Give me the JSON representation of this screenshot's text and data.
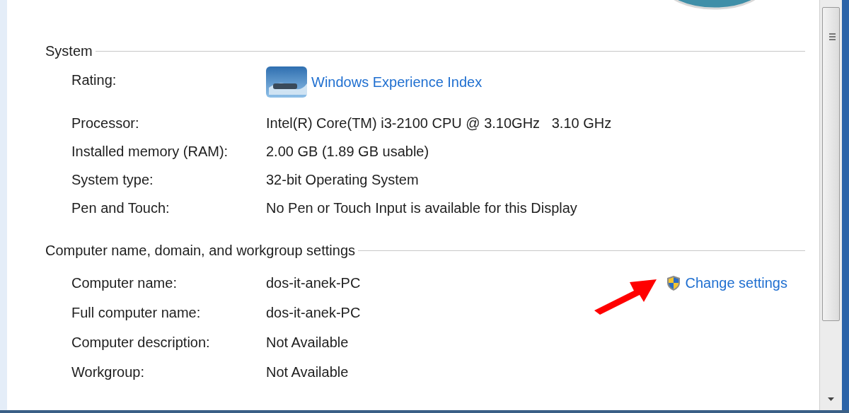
{
  "sections": [
    {
      "heading": "System",
      "rows": [
        {
          "label": "Rating:",
          "value": "Windows Experience Index",
          "kind": "link"
        },
        {
          "label": "Processor:",
          "value": "Intel(R) Core(TM) i3-2100 CPU @ 3.10GHz   3.10 GHz",
          "kind": "text"
        },
        {
          "label": "Installed memory (RAM):",
          "value": "2.00 GB (1.89 GB usable)",
          "kind": "text"
        },
        {
          "label": "System type:",
          "value": "32-bit Operating System",
          "kind": "text"
        },
        {
          "label": "Pen and Touch:",
          "value": "No Pen or Touch Input is available for this Display",
          "kind": "text"
        }
      ]
    },
    {
      "heading": "Computer name, domain, and workgroup settings",
      "action": {
        "label": "Change settings",
        "arrow": true
      },
      "rows": [
        {
          "label": "Computer name:",
          "value": "dos-it-anek-PC",
          "kind": "text"
        },
        {
          "label": "Full computer name:",
          "value": "dos-it-anek-PC",
          "kind": "text"
        },
        {
          "label": "Computer description:",
          "value": "Not Available",
          "kind": "text"
        },
        {
          "label": "Workgroup:",
          "value": "Not Available",
          "kind": "text"
        }
      ]
    }
  ]
}
